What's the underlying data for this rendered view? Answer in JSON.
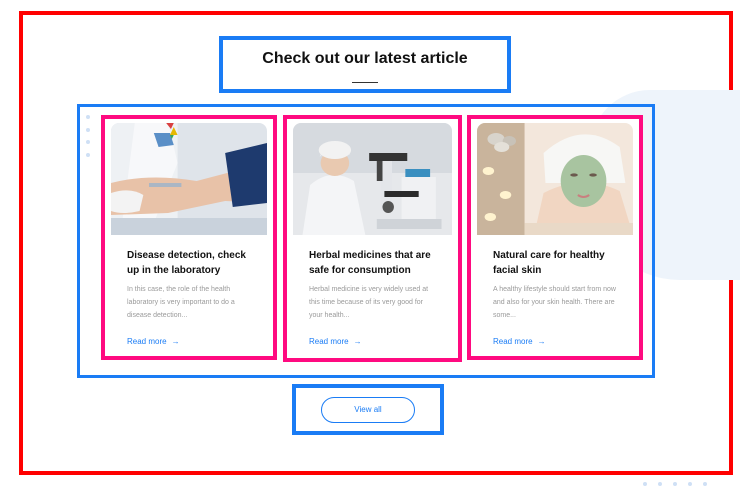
{
  "section": {
    "title": "Check out our latest article"
  },
  "articles": [
    {
      "title": "Disease detection, check up in the laboratory",
      "excerpt": "In this case, the role of the health laboratory is very important to do a disease detection...",
      "link": "Read more",
      "image": "lab-blood-draw-photo"
    },
    {
      "title": "Herbal medicines that are safe for consumption",
      "excerpt": "Herbal medicine is very widely used at this time because of its very good for your health...",
      "link": "Read more",
      "image": "scientist-microscope-photo"
    },
    {
      "title": "Natural care for healthy facial skin",
      "excerpt": "A healthy lifestyle should start from now and also for your skin health. There are some...",
      "link": "Read more",
      "image": "facial-mask-spa-photo"
    }
  ],
  "view_all": {
    "label": "View all"
  },
  "colors": {
    "accent": "#1a7cf5",
    "frame_red": "#ff0000",
    "frame_pink": "#ff0a80"
  },
  "icons": {
    "read_more_arrow": "arrow-right-icon"
  }
}
